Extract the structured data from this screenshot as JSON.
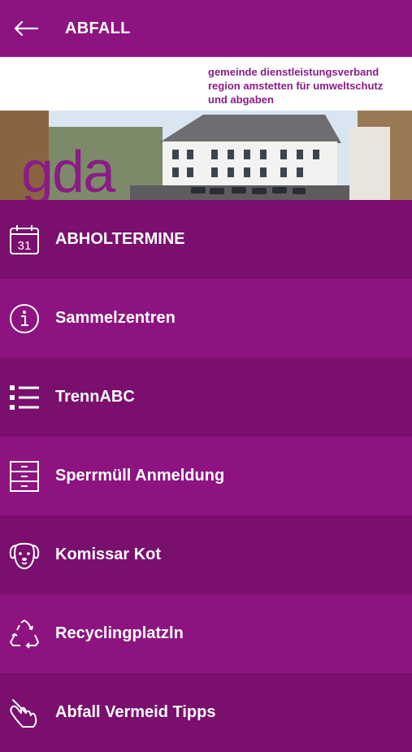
{
  "header": {
    "title": "ABFALL",
    "back_icon": "arrow-left-icon"
  },
  "banner": {
    "logo": "gda",
    "tagline": [
      "gemeinde dienstleistungsverband",
      "region amstetten für umweltschutz",
      "und abgaben"
    ]
  },
  "menu": [
    {
      "label": "ABHOLTERMINE",
      "icon": "calendar-icon",
      "calendar_day": "31"
    },
    {
      "label": "Sammelzentren",
      "icon": "info-icon"
    },
    {
      "label": "TrennABC",
      "icon": "list-icon"
    },
    {
      "label": "Sperrmüll Anmeldung",
      "icon": "cabinet-icon"
    },
    {
      "label": "Komissar Kot",
      "icon": "dog-icon"
    },
    {
      "label": "Recyclingplatzln",
      "icon": "recycle-icon"
    },
    {
      "label": "Abfall Vermeid Tipps",
      "icon": "hand-pointer-icon"
    }
  ],
  "colors": {
    "primary": "#8d1480",
    "primary_dark": "#7a0f6e",
    "logo": "#8a1c86"
  }
}
